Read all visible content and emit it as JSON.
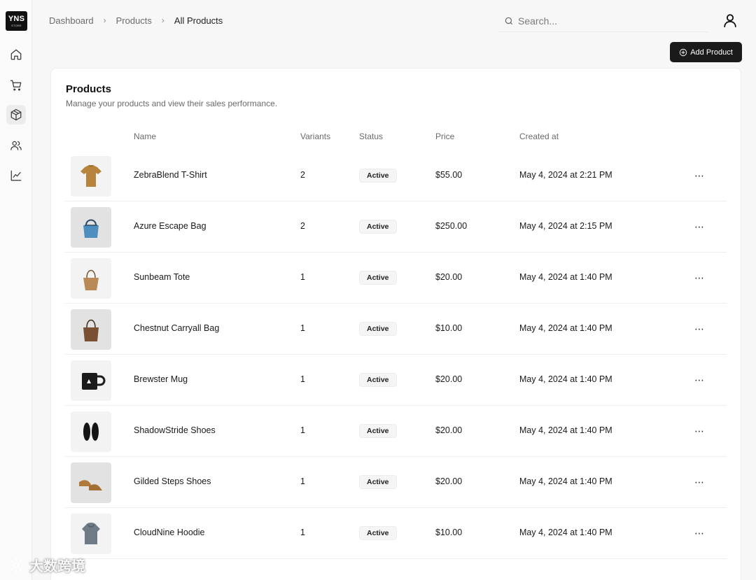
{
  "sidebar": {
    "logo_text": "YNS",
    "logo_subtext": "STORE",
    "items": [
      {
        "name": "home",
        "icon": "home-icon"
      },
      {
        "name": "orders",
        "icon": "cart-icon"
      },
      {
        "name": "products",
        "icon": "package-icon",
        "active": true
      },
      {
        "name": "customers",
        "icon": "users-icon"
      },
      {
        "name": "analytics",
        "icon": "line-chart-icon"
      }
    ],
    "settings_icon": "settings-icon"
  },
  "breadcrumb": [
    "Dashboard",
    "Products",
    "All Products"
  ],
  "search": {
    "placeholder": "Search..."
  },
  "actions": {
    "add_product_label": "Add Product"
  },
  "card": {
    "title": "Products",
    "description": "Manage your products and view their sales performance."
  },
  "table": {
    "columns": [
      "Name",
      "Variants",
      "Status",
      "Price",
      "Created at"
    ],
    "rows": [
      {
        "name": "ZebraBlend T-Shirt",
        "variants": "2",
        "status": "Active",
        "price": "$55.00",
        "created": "May 4, 2024 at 2:21 PM",
        "thumb": "tshirt"
      },
      {
        "name": "Azure Escape Bag",
        "variants": "2",
        "status": "Active",
        "price": "$250.00",
        "created": "May 4, 2024 at 2:15 PM",
        "thumb": "blue-bag"
      },
      {
        "name": "Sunbeam Tote",
        "variants": "1",
        "status": "Active",
        "price": "$20.00",
        "created": "May 4, 2024 at 1:40 PM",
        "thumb": "tote"
      },
      {
        "name": "Chestnut Carryall Bag",
        "variants": "1",
        "status": "Active",
        "price": "$10.00",
        "created": "May 4, 2024 at 1:40 PM",
        "thumb": "brown-bag"
      },
      {
        "name": "Brewster Mug",
        "variants": "1",
        "status": "Active",
        "price": "$20.00",
        "created": "May 4, 2024 at 1:40 PM",
        "thumb": "mug"
      },
      {
        "name": "ShadowStride Shoes",
        "variants": "1",
        "status": "Active",
        "price": "$20.00",
        "created": "May 4, 2024 at 1:40 PM",
        "thumb": "black-shoes"
      },
      {
        "name": "Gilded Steps Shoes",
        "variants": "1",
        "status": "Active",
        "price": "$20.00",
        "created": "May 4, 2024 at 1:40 PM",
        "thumb": "tan-shoes"
      },
      {
        "name": "CloudNine Hoodie",
        "variants": "1",
        "status": "Active",
        "price": "$10.00",
        "created": "May 4, 2024 at 1:40 PM",
        "thumb": "hoodie"
      }
    ]
  },
  "watermark": {
    "text": "大数跨境"
  },
  "colors": {
    "primary_button": "#1a1a1a",
    "badge_bg": "#f5f5f5"
  }
}
